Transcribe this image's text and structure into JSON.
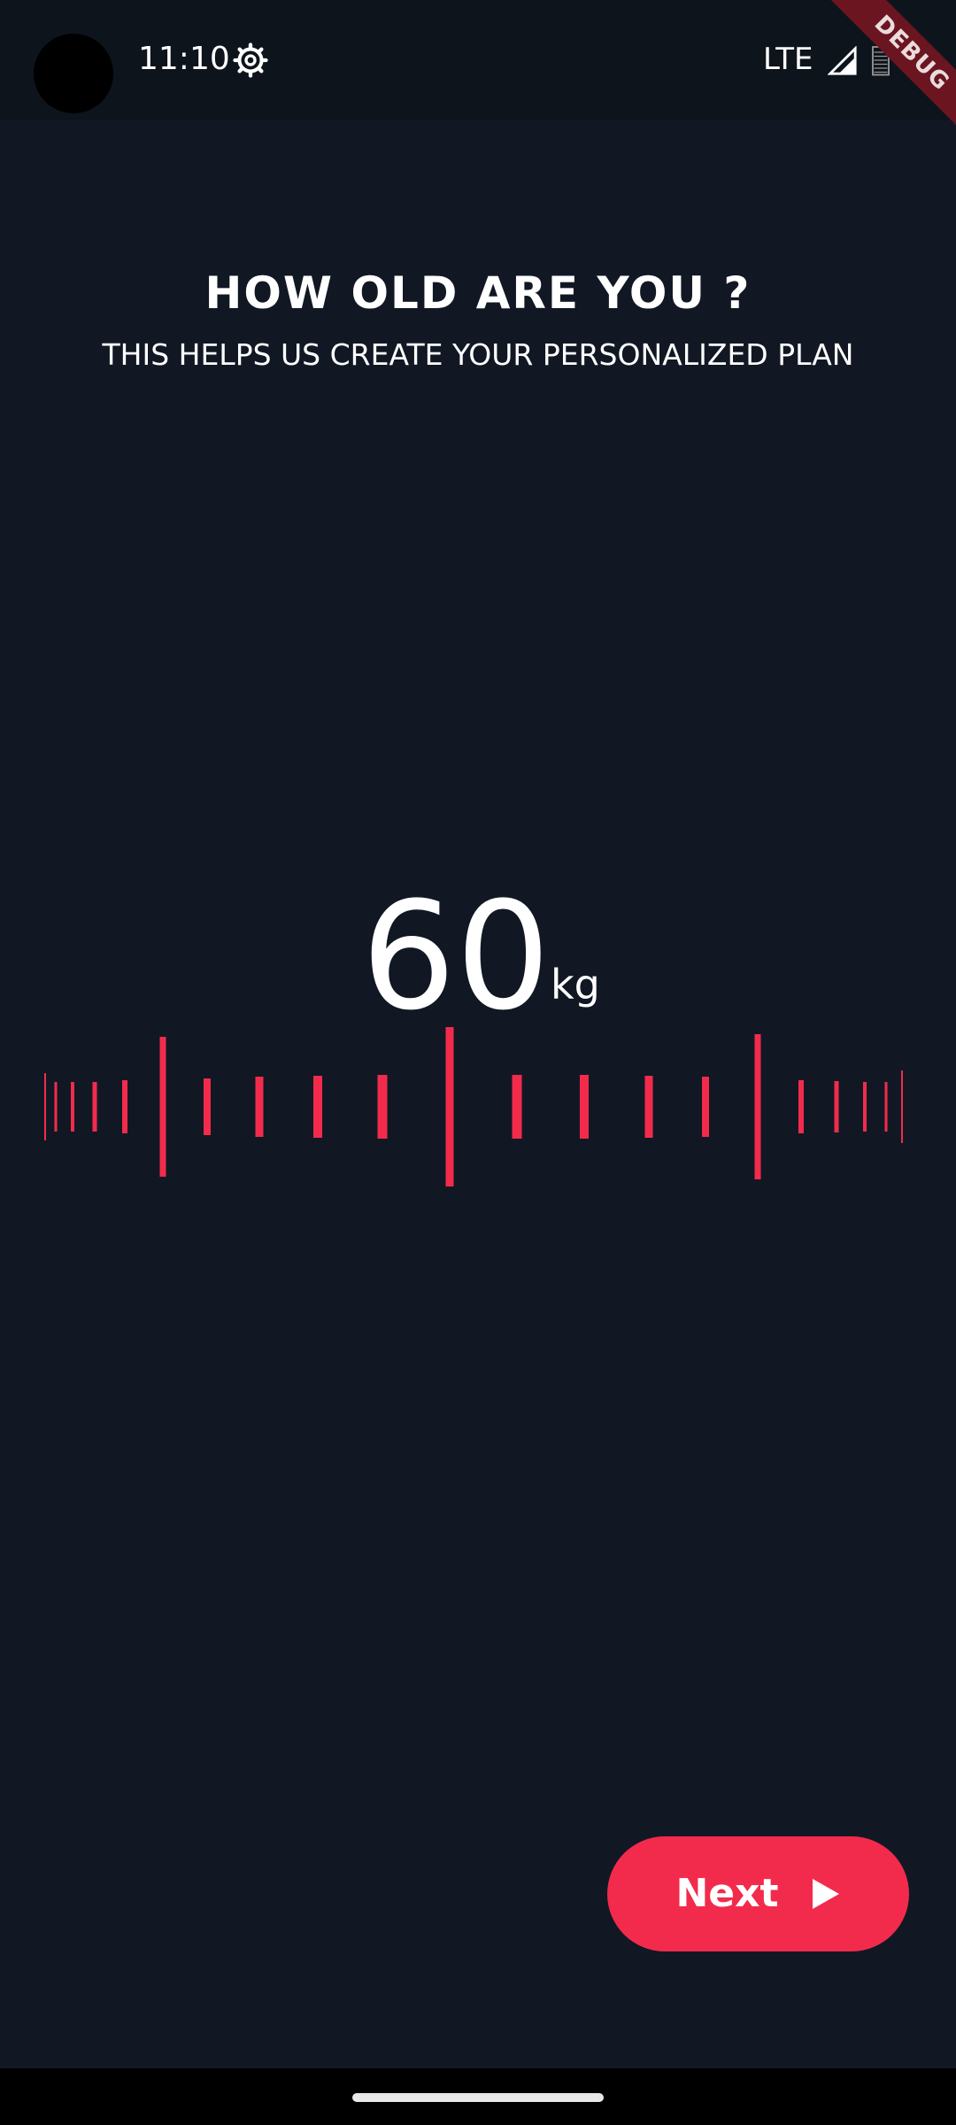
{
  "status_bar": {
    "time": "11:10",
    "network": "LTE",
    "icons": [
      "settings-gear-icon",
      "cell-signal-icon",
      "battery-icon"
    ]
  },
  "debug_banner": "DEBUG",
  "heading": {
    "title": "HOW OLD ARE YOU ?",
    "subtitle": "THIS HELPS US CREATE YOUR PERSONALIZED PLAN"
  },
  "picker": {
    "value": "60",
    "unit": "kg"
  },
  "next_button": {
    "label": "Next",
    "icon": "play-arrow-icon"
  },
  "colors": {
    "background": "#111824",
    "accent": "#f22b4c",
    "text": "#ffffff"
  }
}
